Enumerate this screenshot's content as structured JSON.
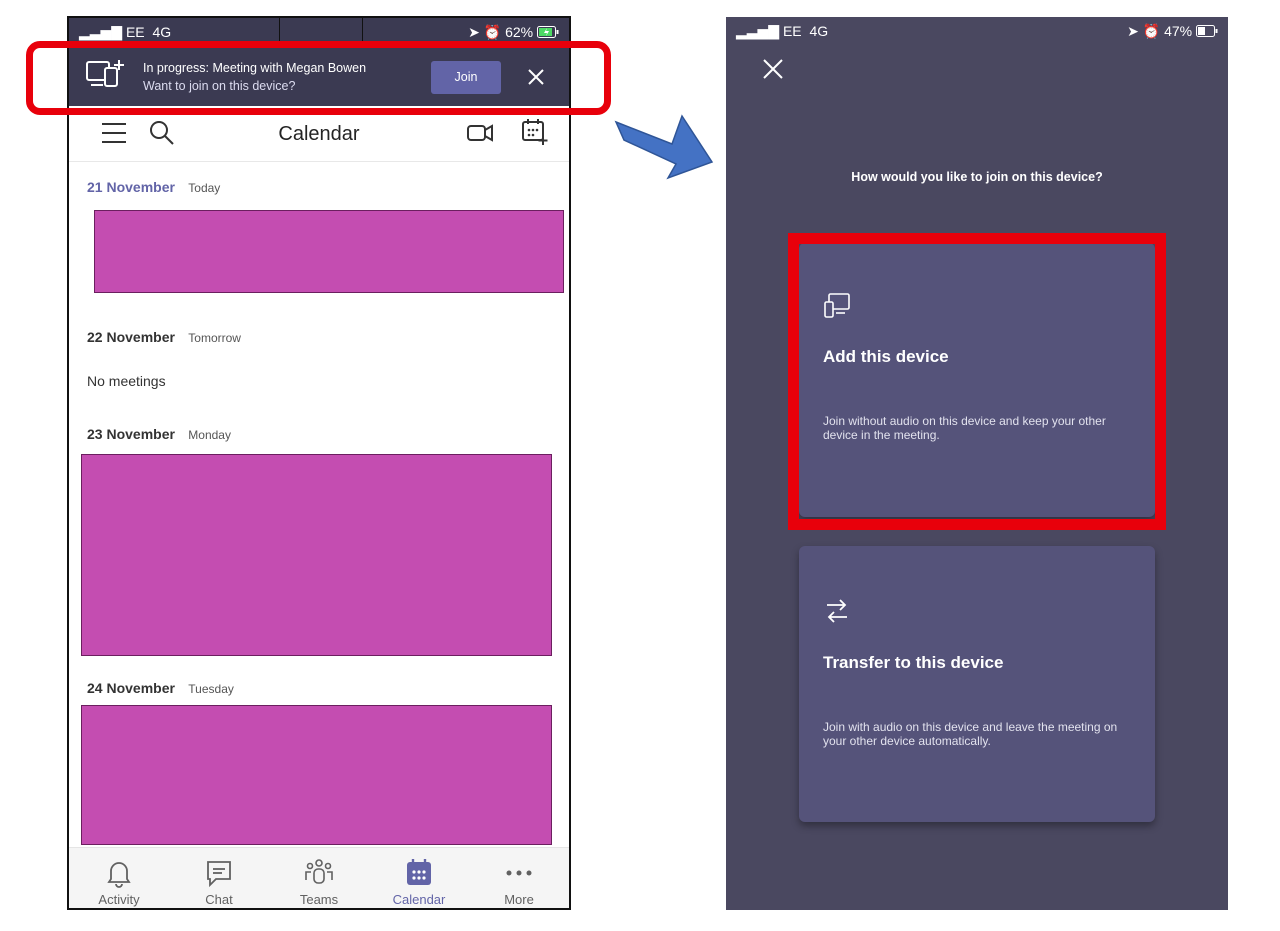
{
  "left_phone": {
    "status_bar": {
      "carrier": "EE",
      "network": "4G",
      "battery": "62%"
    },
    "banner": {
      "title": "In progress: Meeting with Megan Bowen",
      "subtitle": "Want to join on this device?",
      "join_label": "Join",
      "icon": "device-add-icon"
    },
    "header": {
      "title": "Calendar"
    },
    "days": [
      {
        "date": "21 November",
        "relative": "Today"
      },
      {
        "date": "22 November",
        "relative": "Tomorrow",
        "empty_text": "No meetings"
      },
      {
        "date": "23 November",
        "relative": "Monday"
      },
      {
        "date": "24 November",
        "relative": "Tuesday"
      }
    ],
    "tabs": [
      {
        "label": "Activity",
        "icon": "bell-icon"
      },
      {
        "label": "Chat",
        "icon": "chat-icon"
      },
      {
        "label": "Teams",
        "icon": "teams-icon"
      },
      {
        "label": "Calendar",
        "icon": "calendar-icon",
        "active": true
      },
      {
        "label": "More",
        "icon": "more-icon"
      }
    ],
    "accent_color": "#6264a7",
    "meeting_color": "#c44db1"
  },
  "right_phone": {
    "status_bar": {
      "carrier": "EE",
      "network": "4G",
      "battery": "47%"
    },
    "question": "How would you like to join on this device?",
    "options": [
      {
        "title": "Add this device",
        "description": "Join without audio on this device and keep your other device in the meeting.",
        "icon": "device-add-icon"
      },
      {
        "title": "Transfer to this device",
        "description": "Join with audio on this device and leave the meeting on your other device automatically.",
        "icon": "transfer-arrows-icon"
      }
    ],
    "background_color": "#4a4860"
  },
  "highlight_color": "#e8000b",
  "arrow_color": "#4472c4"
}
